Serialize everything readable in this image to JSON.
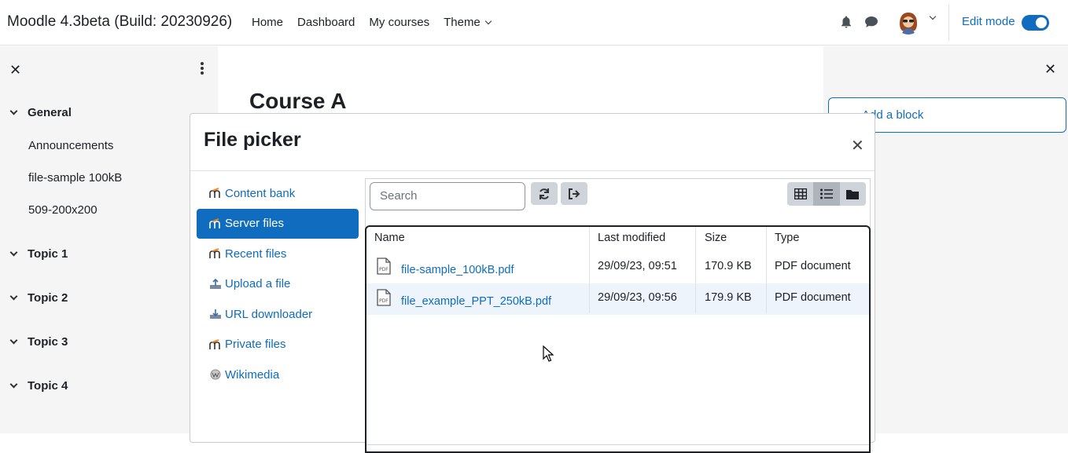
{
  "navbar": {
    "brand": "Moodle 4.3beta (Build: 20230926)",
    "links": [
      "Home",
      "Dashboard",
      "My courses",
      "Theme"
    ],
    "edit_mode_label": "Edit mode"
  },
  "left_drawer": {
    "sections": [
      {
        "title": "General",
        "items": [
          "Announcements",
          "file-sample 100kB",
          "509-200x200"
        ]
      },
      {
        "title": "Topic 1"
      },
      {
        "title": "Topic 2"
      },
      {
        "title": "Topic 3"
      },
      {
        "title": "Topic 4"
      }
    ]
  },
  "main": {
    "course_title": "Course A"
  },
  "right_drawer": {
    "add_block_label": "Add a block"
  },
  "file_picker": {
    "title": "File picker",
    "repositories": [
      "Content bank",
      "Server files",
      "Recent files",
      "Upload a file",
      "URL downloader",
      "Private files",
      "Wikimedia"
    ],
    "active_repository": "Server files",
    "search_placeholder": "Search",
    "columns": [
      "Name",
      "Last modified",
      "Size",
      "Type"
    ],
    "files": [
      {
        "name": "file-sample_100kB.pdf",
        "modified": "29/09/23, 09:51",
        "size": "170.9 KB",
        "type": "PDF document"
      },
      {
        "name": "file_example_PPT_250kB.pdf",
        "modified": "29/09/23, 09:56",
        "size": "179.9 KB",
        "type": "PDF document"
      }
    ]
  },
  "colors": {
    "accent": "#0f6cbf",
    "drawer_bg": "#f5f5f5"
  }
}
